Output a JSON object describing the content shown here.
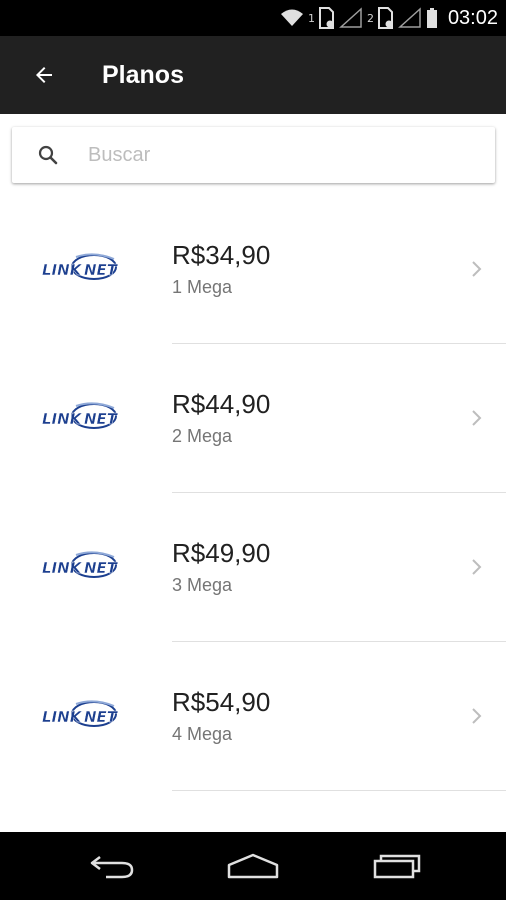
{
  "status_bar": {
    "sim1_label": "1",
    "sim2_label": "2",
    "time": "03:02"
  },
  "app_bar": {
    "title": "Planos",
    "back_icon": "arrow-left-icon"
  },
  "search": {
    "placeholder": "Buscar",
    "value": "",
    "icon": "search-icon"
  },
  "plans": [
    {
      "logo": "LINKNET",
      "price": "R$34,90",
      "speed": "1 Mega"
    },
    {
      "logo": "LINKNET",
      "price": "R$44,90",
      "speed": "2 Mega"
    },
    {
      "logo": "LINKNET",
      "price": "R$49,90",
      "speed": "3 Mega"
    },
    {
      "logo": "LINKNET",
      "price": "R$54,90",
      "speed": "4 Mega"
    }
  ],
  "nav_bar": {
    "icons": [
      "back-nav-icon",
      "home-nav-icon",
      "recent-apps-icon"
    ]
  },
  "colors": {
    "app_bar": "#212121",
    "status_bar": "#000000",
    "logo_blue": "#1c3f8f",
    "price_text": "#212121",
    "speed_text": "#757575"
  }
}
